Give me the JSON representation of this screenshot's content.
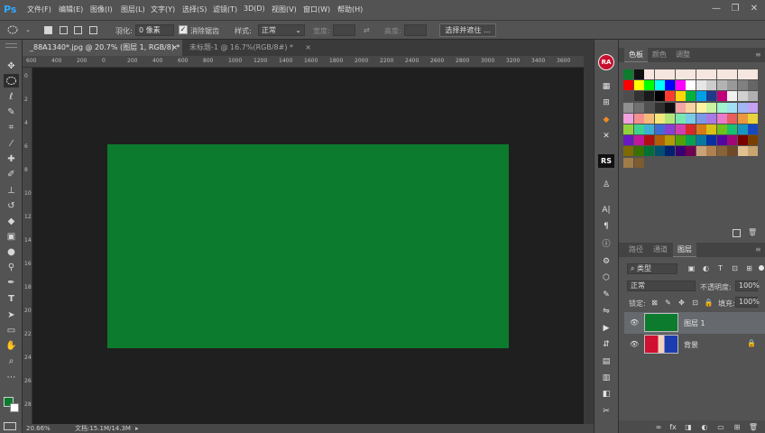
{
  "app": {
    "logo": "Ps"
  },
  "menu": [
    "文件(F)",
    "编辑(E)",
    "图像(I)",
    "图层(L)",
    "文字(Y)",
    "选择(S)",
    "滤镜(T)",
    "3D(D)",
    "视图(V)",
    "窗口(W)",
    "帮助(H)"
  ],
  "window_controls": {
    "minimize": "—",
    "restore": "❐",
    "close": "✕"
  },
  "options": {
    "feather_label": "羽化:",
    "feather_value": "0 像素",
    "antialias_label": "消除锯齿",
    "style_label": "样式:",
    "style_value": "正常",
    "width_label": "宽度:",
    "height_label": "高度:",
    "select_mask_button": "选择并遮住 ..."
  },
  "tabs": [
    {
      "label": "_88A1340*.jpg @ 20.7% (图层 1, RGB/8) *",
      "active": true
    },
    {
      "label": "未标题-1 @ 16.7%(RGB/8#) *",
      "active": false
    }
  ],
  "ruler_top_ticks": [
    "600",
    "400",
    "200",
    "0",
    "200",
    "400",
    "600",
    "800",
    "1000",
    "1200",
    "1400",
    "1600",
    "1800",
    "2000",
    "2200",
    "2400",
    "2600",
    "2800",
    "3000",
    "3200",
    "3400",
    "3600"
  ],
  "ruler_left_ticks": [
    "0",
    "2",
    "4",
    "6",
    "8",
    "10",
    "12",
    "14",
    "16",
    "18",
    "20",
    "22",
    "24",
    "26",
    "28"
  ],
  "canvas": {
    "background_color": "#1f1f1f",
    "layer_color": "#0c7b2d"
  },
  "status": {
    "zoom": "20.66%",
    "doc_info": "文档:15.1M/14.3M",
    "arrow": "▸"
  },
  "strip": {
    "avatar": "RA",
    "rs_badge": "RS",
    "text_tool": "A|",
    "paragraph": "¶"
  },
  "swatch_panel": {
    "tabs": [
      "色板",
      "颜色",
      "调整"
    ],
    "active_tab": "色板"
  },
  "layers_panel": {
    "tabs": [
      "路径",
      "通道",
      "图层"
    ],
    "active_tab": "图层",
    "filter_kind": "类型",
    "blend_mode": "正常",
    "opacity_label": "不透明度:",
    "opacity_value": "100%",
    "lock_label": "锁定:",
    "fill_label": "填充:",
    "fill_value": "100%",
    "layers": [
      {
        "name": "图层 1",
        "selected": true,
        "locked": false
      },
      {
        "name": "背景",
        "selected": false,
        "locked": true
      }
    ],
    "bottom_icons": [
      "∞",
      "fx",
      "◨",
      "◐",
      "▭",
      "⊞",
      "🗑"
    ]
  },
  "colors": {
    "foreground": "#0c7b2d",
    "background": "#ffffff",
    "accent_blue": "#31a8ff"
  }
}
